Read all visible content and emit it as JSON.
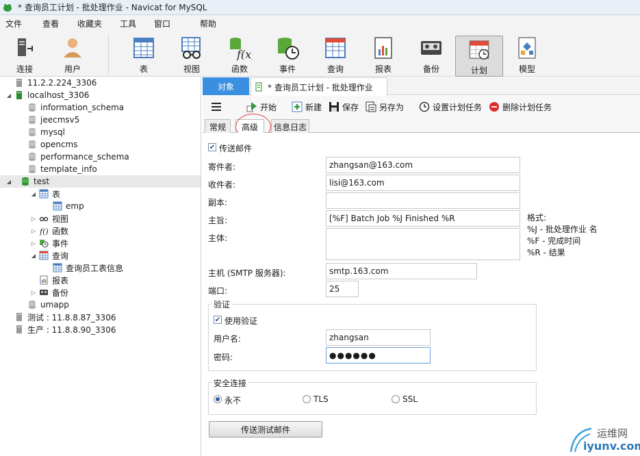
{
  "window": {
    "title": "* 查询员工计划 - 批处理作业 - Navicat for MySQL"
  },
  "menu": [
    "文件",
    "查看",
    "收藏夹",
    "工具",
    "窗口",
    "帮助"
  ],
  "toolbar": {
    "connect": "连接",
    "user": "用户",
    "table": "表",
    "view": "视图",
    "function": "函数",
    "event": "事件",
    "query": "查询",
    "report": "报表",
    "backup": "备份",
    "schedule": "计划",
    "model": "模型"
  },
  "tree": {
    "conn1": "11.2.2.224_3306",
    "conn2": "localhost_3306",
    "db_info": "information_schema",
    "db_jeecms": "jeecmsv5",
    "db_mysql": "mysql",
    "db_opencms": "opencms",
    "db_perf": "performance_schema",
    "db_template": "template_info",
    "db_test": "test",
    "tables": "表",
    "table_emp": "emp",
    "views": "视图",
    "functions": "函数",
    "events": "事件",
    "queries": "查询",
    "query_item": "查询员工表信息",
    "reports": "报表",
    "backups": "备份",
    "db_umapp": "umapp",
    "conn3": "测试 : 11.8.8.87_3306",
    "conn4": "生产 : 11.8.8.90_3306"
  },
  "tabs": {
    "objects": "对象",
    "doc": "* 查询员工计划 - 批处理作业"
  },
  "actions": {
    "start": "开始",
    "new": "新建",
    "save": "保存",
    "save_as": "另存为",
    "set_task": "设置计划任务",
    "delete_task": "删除计划任务"
  },
  "subtabs": [
    "常规",
    "高级",
    "信息日志"
  ],
  "form": {
    "send_mail": "传送邮件",
    "sender_label": "寄件者:",
    "sender": "zhangsan@163.com",
    "recipient_label": "收件者:",
    "recipient": "lisi@163.com",
    "cc_label": "副本:",
    "cc": "",
    "subject_label": "主旨:",
    "subject": "[%F] Batch Job %J Finished %R",
    "body_label": "主体:",
    "body": "",
    "format_title": "格式:",
    "format_j": "%J - 批处理作业 名",
    "format_f": "%F - 完成时间",
    "format_r": "%R - 结果",
    "host_label": "主机 (SMTP 服务器):",
    "host": "smtp.163.com",
    "port_label": "端口:",
    "port": "25",
    "auth_group": "验证",
    "use_auth": "使用验证",
    "username_label": "用户名:",
    "username": "zhangsan",
    "password_label": "密码:",
    "password": "●●●●●●",
    "security_group": "安全连接",
    "sec_never": "永不",
    "sec_tls": "TLS",
    "sec_ssl": "SSL",
    "send_test": "传送测试邮件"
  },
  "watermark": {
    "text_cn": "运维网",
    "text_en": "iyunv.com"
  }
}
